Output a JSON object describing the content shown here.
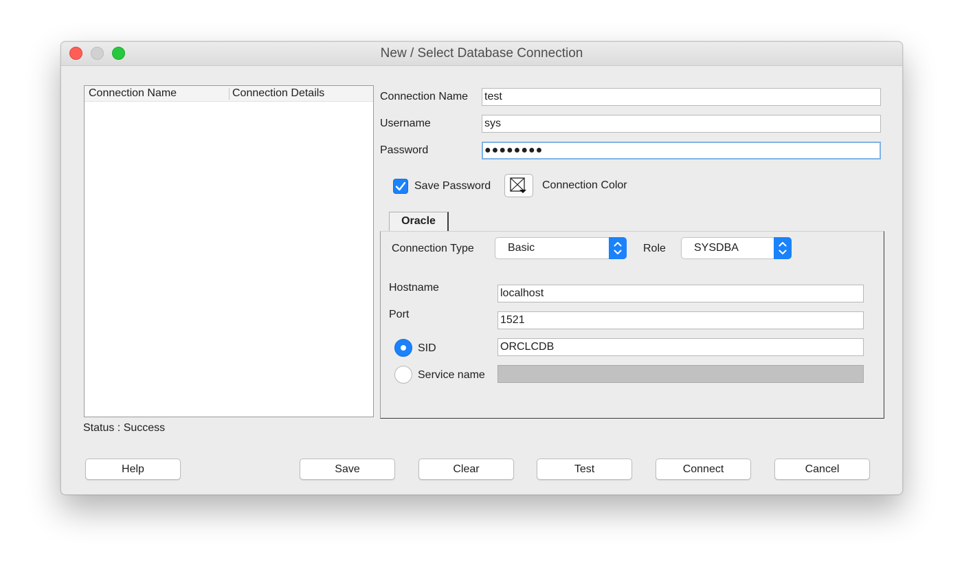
{
  "window": {
    "title": "New / Select Database Connection"
  },
  "list": {
    "columns": [
      "Connection Name",
      "Connection Details"
    ],
    "rows": []
  },
  "status": "Status : Success",
  "form": {
    "connection_name_label": "Connection Name",
    "connection_name_value": "test",
    "username_label": "Username",
    "username_value": "sys",
    "password_label": "Password",
    "password_value": "●●●●●●●●",
    "save_password_label": "Save Password",
    "save_password_checked": true,
    "connection_color_label": "Connection Color"
  },
  "tabs": [
    {
      "label": "Oracle",
      "active": true
    }
  ],
  "oracle": {
    "connection_type_label": "Connection Type",
    "connection_type_value": "Basic",
    "role_label": "Role",
    "role_value": "SYSDBA",
    "hostname_label": "Hostname",
    "hostname_value": "localhost",
    "port_label": "Port",
    "port_value": "1521",
    "sid_label": "SID",
    "sid_value": "ORCLCDB",
    "sid_selected": true,
    "service_name_label": "Service name",
    "service_name_value": ""
  },
  "buttons": {
    "help": "Help",
    "save": "Save",
    "clear": "Clear",
    "test": "Test",
    "connect": "Connect",
    "cancel": "Cancel"
  },
  "colors": {
    "accent": "#1a82fb",
    "close": "#fd5f57",
    "minimize": "#d1d1d1",
    "maximize": "#27c840"
  }
}
